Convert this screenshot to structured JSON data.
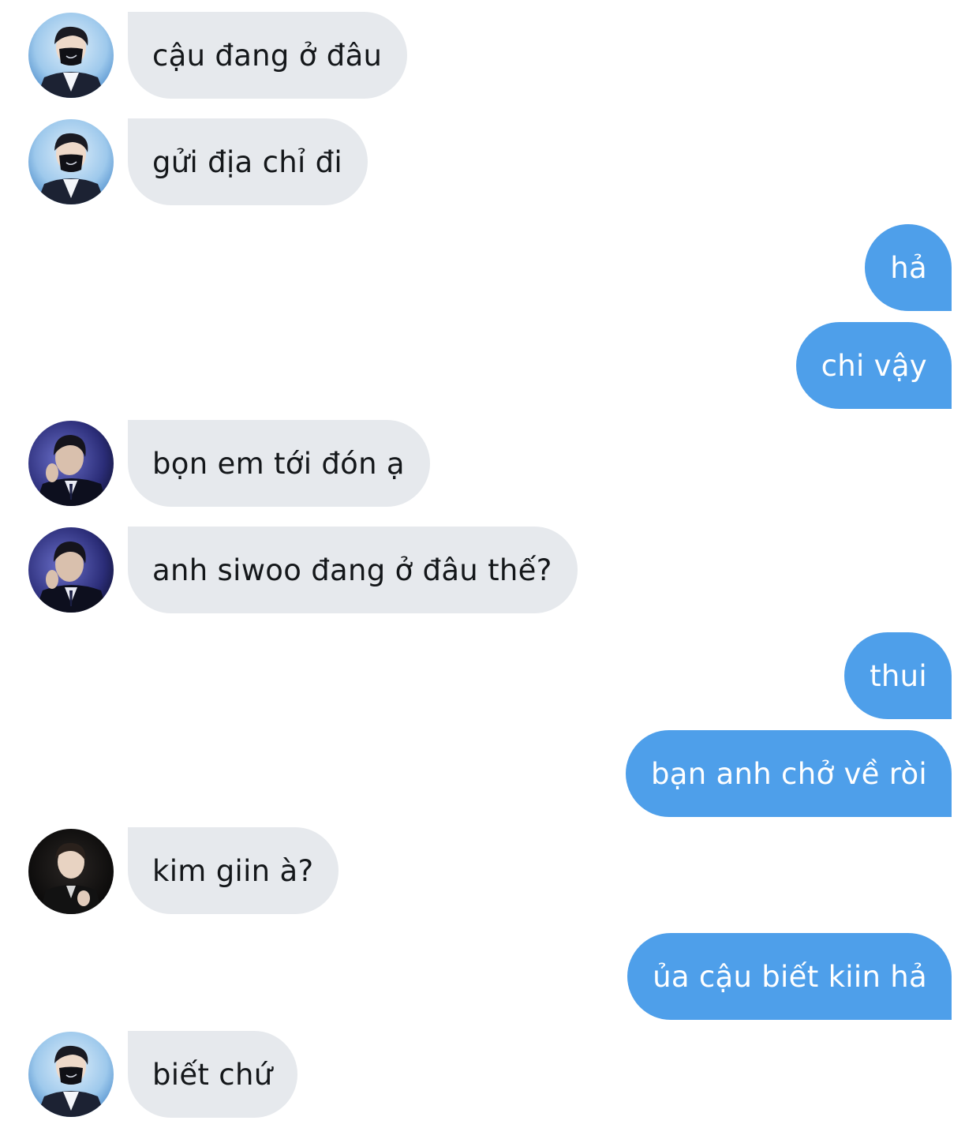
{
  "messages": [
    {
      "side": "in",
      "avatar": "avatar-masked-blue-stage",
      "text": "cậu đang ở đâu"
    },
    {
      "side": "in",
      "avatar": "avatar-masked-blue-stage",
      "text": "gửi địa chỉ đi"
    },
    {
      "side": "out",
      "text": "hả"
    },
    {
      "side": "out",
      "text": "chi vậy"
    },
    {
      "side": "in",
      "avatar": "avatar-suit-purple-stage",
      "text": "bọn em tới đón ạ"
    },
    {
      "side": "in",
      "avatar": "avatar-suit-purple-stage",
      "text": "anh siwoo đang ở đâu thế?"
    },
    {
      "side": "out",
      "text": "thui"
    },
    {
      "side": "out",
      "text": "bạn anh chở về ròi"
    },
    {
      "side": "in",
      "avatar": "avatar-dark-portrait",
      "text": "kim giin à?"
    },
    {
      "side": "out",
      "text": "ủa cậu biết kiin hả"
    },
    {
      "side": "in",
      "avatar": "avatar-masked-blue-stage",
      "text": "biết chứ"
    }
  ],
  "colors": {
    "incoming_bubble": "#e6e9ed",
    "incoming_text": "#14171a",
    "outgoing_bubble": "#4e9fea",
    "outgoing_text": "#ffffff"
  }
}
